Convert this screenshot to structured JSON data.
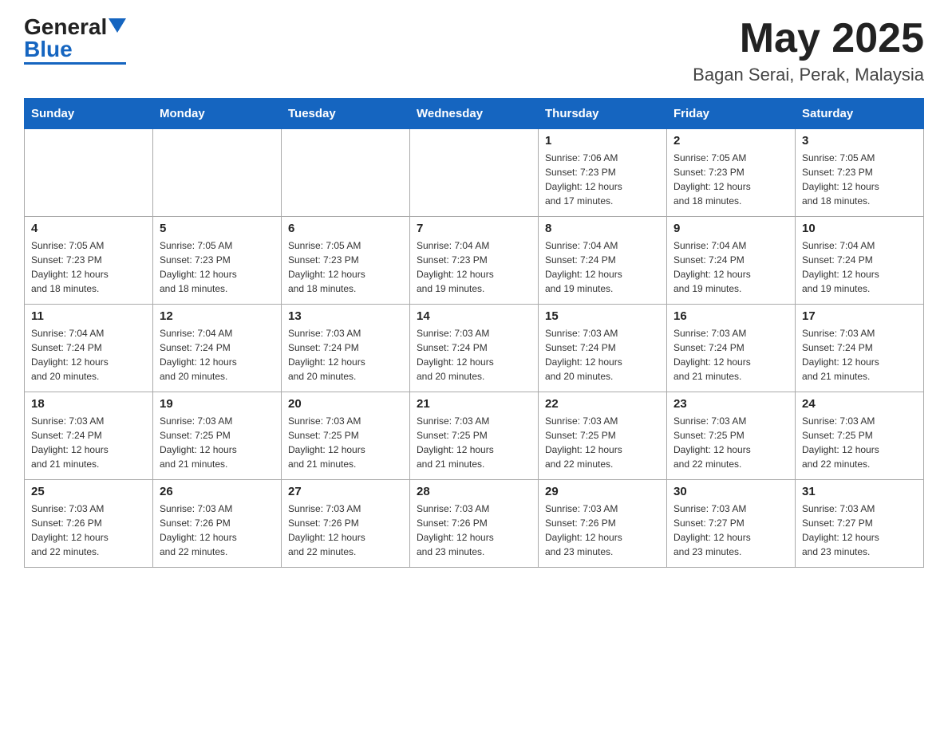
{
  "header": {
    "logo_text_black": "General",
    "logo_text_blue": "Blue",
    "month_title": "May 2025",
    "location": "Bagan Serai, Perak, Malaysia"
  },
  "days_of_week": [
    "Sunday",
    "Monday",
    "Tuesday",
    "Wednesday",
    "Thursday",
    "Friday",
    "Saturday"
  ],
  "weeks": [
    [
      {
        "day": "",
        "info": ""
      },
      {
        "day": "",
        "info": ""
      },
      {
        "day": "",
        "info": ""
      },
      {
        "day": "",
        "info": ""
      },
      {
        "day": "1",
        "info": "Sunrise: 7:06 AM\nSunset: 7:23 PM\nDaylight: 12 hours\nand 17 minutes."
      },
      {
        "day": "2",
        "info": "Sunrise: 7:05 AM\nSunset: 7:23 PM\nDaylight: 12 hours\nand 18 minutes."
      },
      {
        "day": "3",
        "info": "Sunrise: 7:05 AM\nSunset: 7:23 PM\nDaylight: 12 hours\nand 18 minutes."
      }
    ],
    [
      {
        "day": "4",
        "info": "Sunrise: 7:05 AM\nSunset: 7:23 PM\nDaylight: 12 hours\nand 18 minutes."
      },
      {
        "day": "5",
        "info": "Sunrise: 7:05 AM\nSunset: 7:23 PM\nDaylight: 12 hours\nand 18 minutes."
      },
      {
        "day": "6",
        "info": "Sunrise: 7:05 AM\nSunset: 7:23 PM\nDaylight: 12 hours\nand 18 minutes."
      },
      {
        "day": "7",
        "info": "Sunrise: 7:04 AM\nSunset: 7:23 PM\nDaylight: 12 hours\nand 19 minutes."
      },
      {
        "day": "8",
        "info": "Sunrise: 7:04 AM\nSunset: 7:24 PM\nDaylight: 12 hours\nand 19 minutes."
      },
      {
        "day": "9",
        "info": "Sunrise: 7:04 AM\nSunset: 7:24 PM\nDaylight: 12 hours\nand 19 minutes."
      },
      {
        "day": "10",
        "info": "Sunrise: 7:04 AM\nSunset: 7:24 PM\nDaylight: 12 hours\nand 19 minutes."
      }
    ],
    [
      {
        "day": "11",
        "info": "Sunrise: 7:04 AM\nSunset: 7:24 PM\nDaylight: 12 hours\nand 20 minutes."
      },
      {
        "day": "12",
        "info": "Sunrise: 7:04 AM\nSunset: 7:24 PM\nDaylight: 12 hours\nand 20 minutes."
      },
      {
        "day": "13",
        "info": "Sunrise: 7:03 AM\nSunset: 7:24 PM\nDaylight: 12 hours\nand 20 minutes."
      },
      {
        "day": "14",
        "info": "Sunrise: 7:03 AM\nSunset: 7:24 PM\nDaylight: 12 hours\nand 20 minutes."
      },
      {
        "day": "15",
        "info": "Sunrise: 7:03 AM\nSunset: 7:24 PM\nDaylight: 12 hours\nand 20 minutes."
      },
      {
        "day": "16",
        "info": "Sunrise: 7:03 AM\nSunset: 7:24 PM\nDaylight: 12 hours\nand 21 minutes."
      },
      {
        "day": "17",
        "info": "Sunrise: 7:03 AM\nSunset: 7:24 PM\nDaylight: 12 hours\nand 21 minutes."
      }
    ],
    [
      {
        "day": "18",
        "info": "Sunrise: 7:03 AM\nSunset: 7:24 PM\nDaylight: 12 hours\nand 21 minutes."
      },
      {
        "day": "19",
        "info": "Sunrise: 7:03 AM\nSunset: 7:25 PM\nDaylight: 12 hours\nand 21 minutes."
      },
      {
        "day": "20",
        "info": "Sunrise: 7:03 AM\nSunset: 7:25 PM\nDaylight: 12 hours\nand 21 minutes."
      },
      {
        "day": "21",
        "info": "Sunrise: 7:03 AM\nSunset: 7:25 PM\nDaylight: 12 hours\nand 21 minutes."
      },
      {
        "day": "22",
        "info": "Sunrise: 7:03 AM\nSunset: 7:25 PM\nDaylight: 12 hours\nand 22 minutes."
      },
      {
        "day": "23",
        "info": "Sunrise: 7:03 AM\nSunset: 7:25 PM\nDaylight: 12 hours\nand 22 minutes."
      },
      {
        "day": "24",
        "info": "Sunrise: 7:03 AM\nSunset: 7:25 PM\nDaylight: 12 hours\nand 22 minutes."
      }
    ],
    [
      {
        "day": "25",
        "info": "Sunrise: 7:03 AM\nSunset: 7:26 PM\nDaylight: 12 hours\nand 22 minutes."
      },
      {
        "day": "26",
        "info": "Sunrise: 7:03 AM\nSunset: 7:26 PM\nDaylight: 12 hours\nand 22 minutes."
      },
      {
        "day": "27",
        "info": "Sunrise: 7:03 AM\nSunset: 7:26 PM\nDaylight: 12 hours\nand 22 minutes."
      },
      {
        "day": "28",
        "info": "Sunrise: 7:03 AM\nSunset: 7:26 PM\nDaylight: 12 hours\nand 23 minutes."
      },
      {
        "day": "29",
        "info": "Sunrise: 7:03 AM\nSunset: 7:26 PM\nDaylight: 12 hours\nand 23 minutes."
      },
      {
        "day": "30",
        "info": "Sunrise: 7:03 AM\nSunset: 7:27 PM\nDaylight: 12 hours\nand 23 minutes."
      },
      {
        "day": "31",
        "info": "Sunrise: 7:03 AM\nSunset: 7:27 PM\nDaylight: 12 hours\nand 23 minutes."
      }
    ]
  ]
}
